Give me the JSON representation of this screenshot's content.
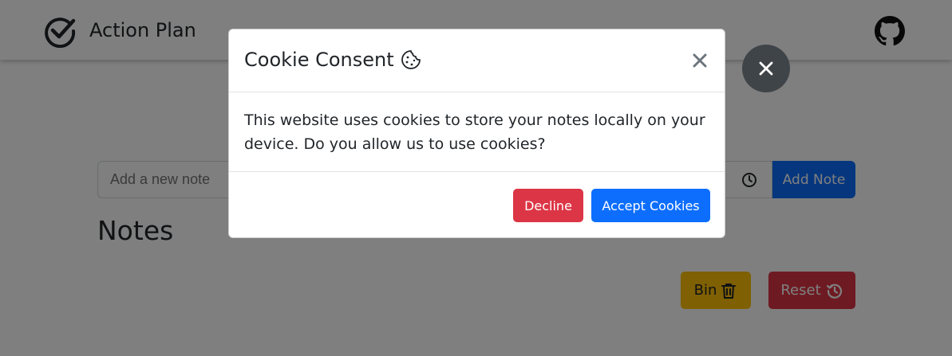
{
  "navbar": {
    "title": "Action Plan",
    "brand_icon": "check-circle-icon",
    "github_icon": "github-icon"
  },
  "note_form": {
    "placeholder": "Add a new note",
    "clock_icon": "clock-icon",
    "add_label": "Add Note"
  },
  "notes": {
    "heading": "Notes",
    "bin_label": "Bin",
    "bin_icon": "trash-icon",
    "reset_label": "Reset",
    "reset_icon": "history-icon"
  },
  "modal": {
    "title": "Cookie Consent",
    "title_icon": "cookie-icon",
    "body": "This website uses cookies to store your notes locally on your device. Do you allow us to use cookies?",
    "decline_label": "Decline",
    "accept_label": "Accept Cookies"
  },
  "colors": {
    "primary": "#0d6efd",
    "danger": "#dc3545",
    "warning": "#ffc107",
    "backdrop": "rgba(0,0,0,0.5)"
  }
}
